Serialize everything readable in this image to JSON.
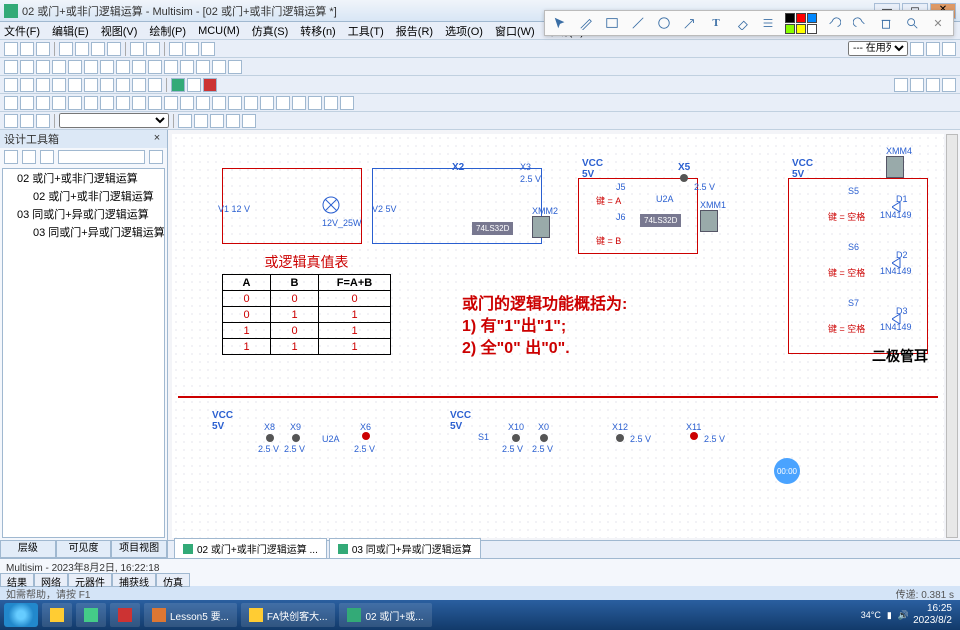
{
  "window": {
    "title": "02 或门+或非门逻辑运算 - Multisim - [02 或门+或非门逻辑运算 *]"
  },
  "menus": [
    "文件(F)",
    "编辑(E)",
    "视图(V)",
    "绘制(P)",
    "MCU(M)",
    "仿真(S)",
    "转移(n)",
    "工具(T)",
    "报告(R)",
    "选项(O)",
    "窗口(W)",
    "帮助(H)"
  ],
  "combo1": "--- 在用列表 ---",
  "sidebar": {
    "title": "设计工具箱",
    "tree": {
      "root": "02 或门+或非门逻辑运算",
      "leaf1": "02 或门+或非门逻辑运算",
      "root2": "03 同或门+异或门逻辑运算",
      "leaf2": "03 同或门+异或门逻辑运算"
    },
    "tabs": [
      "层级",
      "可见度",
      "项目视图"
    ]
  },
  "truth": {
    "caption": "或逻辑真值表",
    "headers": [
      "A",
      "B",
      "F=A+B"
    ],
    "rows": [
      [
        "0",
        "0",
        "0"
      ],
      [
        "0",
        "1",
        "1"
      ],
      [
        "1",
        "0",
        "1"
      ],
      [
        "1",
        "1",
        "1"
      ]
    ]
  },
  "explain": {
    "l1": "或门的逻辑功能概括为:",
    "l2": "1) 有\"1\"出\"1\";",
    "l3": "2) 全\"0\" 出\"0\"."
  },
  "labels": {
    "vcc5v": "VCC\n5V",
    "x5": "X5",
    "x2v5": "2.5 V",
    "keyA": "键 = A",
    "keyB": "键 = B",
    "keySpace": "键 = 空格",
    "ic": "74LS32D",
    "u2a": "U2A",
    "d1": "D1",
    "d2": "D2",
    "d3": "D3",
    "diode": "1N4149",
    "v1": "V1\n12 V",
    "v2": "V2\n5V",
    "lamp": "12V_25W",
    "s5": "S5",
    "s6": "S6",
    "s7": "S7",
    "j5": "J5",
    "j6": "J6",
    "xmm1": "XMM1",
    "xmm2": "XMM2",
    "xmm4": "XMM4",
    "x8": "X8",
    "x9": "X9",
    "x10": "X10",
    "x11": "X11",
    "x12": "X12",
    "x2": "X2",
    "x3": "X3",
    "rt": "二极管耳",
    "s1": "S1"
  },
  "maintabs": [
    "02 或门+或非门逻辑运算 ...",
    "03 同或门+异或门逻辑运算"
  ],
  "status": {
    "app": "Multisim",
    "dt": "2023年8月2日, 16:22:18",
    "tabs": [
      "结果",
      "网络",
      "元器件",
      "捕获线",
      "仿真"
    ],
    "hint": "如需帮助，请按 F1",
    "elapsed": "传递: 0.381 s"
  },
  "timebadge": "00:00",
  "taskbar": {
    "items": [
      "Lesson5 要...",
      "FA快创客大...",
      "02 或门+或..."
    ],
    "temp": "34°C",
    "time": "16:25",
    "date": "2023/8/2"
  },
  "swatches": [
    "#000",
    "#f00",
    "#08f",
    "#8f0",
    "#ff0",
    "#fff"
  ]
}
